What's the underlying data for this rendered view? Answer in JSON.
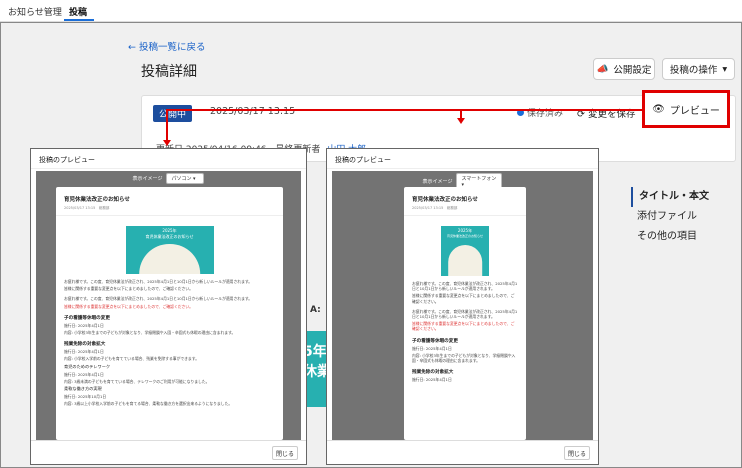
{
  "topbar": {
    "tab1": "お知らせ管理",
    "tab2": "投稿"
  },
  "main": {
    "back_link": "← 投稿一覧に戻る",
    "title": "投稿詳細",
    "publish_btn": "公開設定",
    "ops_btn": "投稿の操作",
    "status_badge": "公開中",
    "date": "2025/03/17 13:15",
    "saved": "保存済み",
    "save_changes": "変更を保存",
    "preview": "プレビュー",
    "updated_label": "更新日 2025/04/16 09:46",
    "updater_label": "最終更新者",
    "updater": "山田 太郎"
  },
  "sidenav": [
    "タイトル・本文",
    "添付ファイル",
    "その他の項目"
  ],
  "modal": {
    "title": "投稿のプレビュー",
    "display_label": "表示イメージ",
    "option_pc": "パソコン",
    "option_sp": "スマートフォン",
    "close": "閉じる"
  },
  "article": {
    "title": "育児休業法改正のお知らせ",
    "date": "2025/03/17 13:15",
    "category": "総務部",
    "hero_year": "2025年",
    "hero_text": "育児休業法改正のお知らせ",
    "p1": "お疲れ様です。この度、育児休業法が改正され、2025年4月1日と10月1日から新しいルールが適用されます。",
    "p1b": "皆様に関係する重要な変更点を以下にまとめましたので、ご確認ください。",
    "p2": "お疲れ様です。この度、育児休業法が改正され、2025年4月1日と10月1日から新しいルールが適用されます。",
    "p2_red": "皆様に関係する重要な変更点を以下にまとめましたので、ご確認ください。",
    "sec1": "子の看護等休暇の変更",
    "s1a": "施行日: 2025年4月1日",
    "s1b": "内容: 小学校3年生までの子どもが対象となり、学級閉鎖や入園・卒園式も休暇の理由に含まれます。",
    "sec2": "残業免除の対象拡大",
    "s2a": "施行日: 2025年4月1日",
    "s2b": "内容: 小学校入学前の子どもを育てている場合、残業を免除する事ができます。",
    "sub1": "育児のためのテレワーク",
    "s3a": "施行日: 2025年4月1日",
    "s3b": "内容: 3歳未満の子どもを育てている場合、テレワークのご利用が可能になりました。",
    "sub2": "柔軟な働き方の実現",
    "s4a": "施行日: 2025年10月1日",
    "s4b": "内容: 3歳以上小学校入学前の子どもを育てる場合、柔軟な働き方を選択出来るようになりました。"
  },
  "bg_fragment": {
    "a": "A:",
    "b": "5年",
    "c": "休業"
  }
}
